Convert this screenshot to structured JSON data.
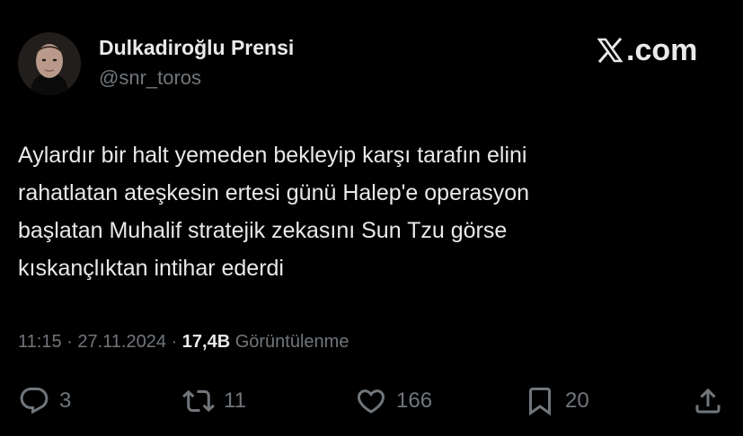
{
  "user": {
    "display_name": "Dulkadiroğlu Prensi",
    "handle": "@snr_toros"
  },
  "brand": {
    "logo_text": ".com",
    "logo_icon": "x-logo-icon"
  },
  "tweet": {
    "lines": [
      "Aylardır bir halt yemeden bekleyip karşı tarafın elini",
      "rahatlatan ateşkesin ertesi günü Halep'e operasyon",
      "başlatan Muhalif stratejik zekasını Sun Tzu görse",
      "kıskançlıktan intihar ederdi"
    ]
  },
  "meta": {
    "time": "11:15",
    "separator": " · ",
    "date": "27.11.2024",
    "views_count": "17,4B",
    "views_label": "Görüntülenme"
  },
  "actions": {
    "replies": "3",
    "reposts": "11",
    "likes": "166",
    "bookmarks": "20"
  },
  "colors": {
    "background": "#000000",
    "primary_text": "#e7e9ea",
    "secondary_text": "#71767b"
  }
}
